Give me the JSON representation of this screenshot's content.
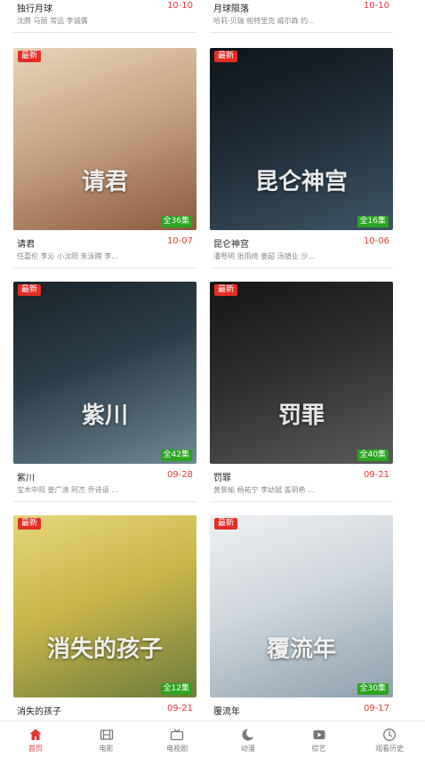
{
  "top_row": [
    {
      "title": "独行月球",
      "date": "10-10",
      "cast": "沈腾 马丽 常远 李诚儒"
    },
    {
      "title": "月球陨落",
      "date": "10-10",
      "cast": "哈莉·贝瑞 帕特里克·威尔森 约..."
    }
  ],
  "cards": [
    {
      "title": "请君",
      "date": "10-07",
      "cast": "任嘉伦 李沁 小沈阳 朱泳腾 李...",
      "badge": "最新",
      "episodes": "全36集",
      "poster_text": "请君",
      "colors": [
        "#c7a583",
        "#8b5a3c",
        "#e8d4b8"
      ]
    },
    {
      "title": "昆仑神宫",
      "date": "10-06",
      "cast": "潘粤明 张雨绮 姜超 汤镇业 沙...",
      "badge": "最新",
      "episodes": "全16集",
      "poster_text": "昆仑神宫",
      "colors": [
        "#1f2b36",
        "#3d5566",
        "#0e1419"
      ]
    },
    {
      "title": "紫川",
      "date": "09-28",
      "cast": "宝木中阳 姜广涛 阿杰 乔诗语 ...",
      "badge": "最新",
      "episodes": "全42集",
      "poster_text": "紫川",
      "colors": [
        "#2c3e4a",
        "#6f8894",
        "#1a2228"
      ]
    },
    {
      "title": "罚罪",
      "date": "09-21",
      "cast": "黄景瑜 杨祐宁 李幼斌 盖玥希 ...",
      "badge": "最新",
      "episodes": "全40集",
      "poster_text": "罚罪",
      "colors": [
        "#2e2e2e",
        "#5a5a5a",
        "#151515"
      ]
    },
    {
      "title": "消失的孩子",
      "date": "09-21",
      "cast": "",
      "badge": "最新",
      "episodes": "全12集",
      "poster_text": "消失的孩子",
      "colors": [
        "#c9b64a",
        "#6e7b3e",
        "#e4d67a"
      ]
    },
    {
      "title": "覆流年",
      "date": "09-17",
      "cast": "",
      "badge": "最新",
      "episodes": "全30集",
      "poster_text": "覆流年",
      "colors": [
        "#cfd6dc",
        "#8ea0ae",
        "#eef1f3"
      ]
    }
  ],
  "tabs": [
    {
      "label": "首页",
      "icon": "home-icon",
      "active": true
    },
    {
      "label": "电影",
      "icon": "film-icon",
      "active": false
    },
    {
      "label": "电视剧",
      "icon": "tv-icon",
      "active": false
    },
    {
      "label": "动漫",
      "icon": "anime-icon",
      "active": false
    },
    {
      "label": "综艺",
      "icon": "play-icon",
      "active": false
    },
    {
      "label": "观看历史",
      "icon": "history-icon",
      "active": false
    }
  ]
}
